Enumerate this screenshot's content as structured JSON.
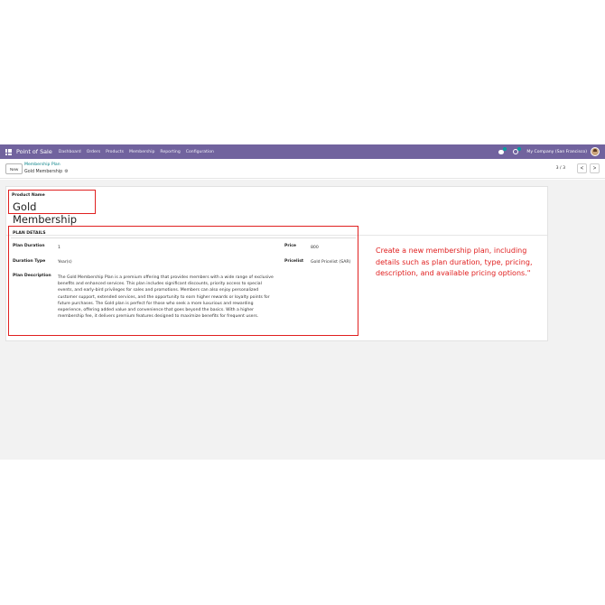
{
  "navbar": {
    "app_title": "Point of Sale",
    "menu": [
      "Dashboard",
      "Orders",
      "Products",
      "Membership",
      "Reporting",
      "Configuration"
    ],
    "company": "My Company (San Francisco)",
    "bg_color": "#71639e"
  },
  "control": {
    "new_label": "New",
    "breadcrumb": "Membership Plan",
    "record_name": "Gold Membership",
    "pager": "3 / 3",
    "prev": "<",
    "next": ">"
  },
  "form": {
    "product_name_label": "Product Name",
    "product_name": "Gold Membership",
    "section_title": "PLAN DETAILS",
    "plan_duration_label": "Plan Duration",
    "plan_duration": "1",
    "duration_type_label": "Duration Type",
    "duration_type": "Year(s)",
    "plan_description_label": "Plan Description",
    "plan_description": "The Gold Membership Plan is a premium offering that provides members with a wide range of exclusive benefits and enhanced services. This plan includes significant discounts, priority access to special events, and early-bird privileges for sales and promotions. Members can also enjoy personalized customer support, extended services, and the opportunity to earn higher rewards or loyalty points for future purchases. The Gold plan is perfect for those who seek a more luxurious and rewarding experience, offering added value and convenience that goes beyond the basics. With a higher membership fee, it delivers premium features designed to maximize benefits for frequent users.",
    "price_label": "Price",
    "price": "800",
    "pricelist_label": "Pricelist",
    "pricelist": "Gold Pricelist (SAR)"
  },
  "annotation": "Create a new membership plan, including details such as plan duration, type, pricing, description, and available pricing options.\"",
  "colors": {
    "highlight": "#e02020",
    "accent": "#017e84"
  },
  "icons": [
    "apps-icon",
    "chat-icon",
    "activity-icon",
    "avatar",
    "gear-icon"
  ]
}
